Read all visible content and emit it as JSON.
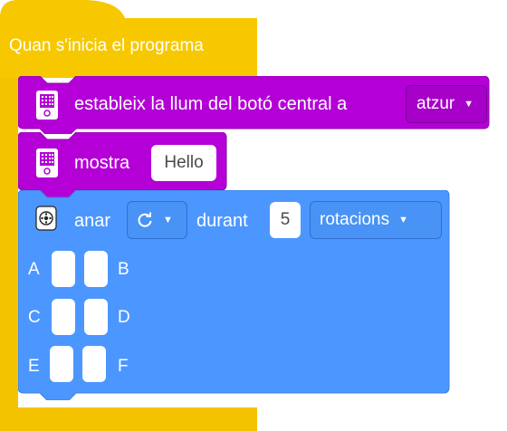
{
  "hat": {
    "label": "Quan s'inicia el programa",
    "color": "#f5c400"
  },
  "block1": {
    "text": "estableix la llum del botó central a",
    "color_value": "atzur",
    "block_color": "#b400d7"
  },
  "block2": {
    "text": "mostra",
    "value": "Hello",
    "block_color": "#b400d7"
  },
  "block3": {
    "go_label": "anar",
    "direction_icon": "rotate-clockwise-icon",
    "during_label": "durant",
    "amount": "5",
    "unit": "rotacions",
    "block_color": "#4c97ff",
    "ports": [
      "A",
      "B",
      "C",
      "D",
      "E",
      "F"
    ]
  },
  "icons": {
    "hub": "hub-icon",
    "motor": "motor-icon",
    "caret": "caret-down-icon"
  }
}
